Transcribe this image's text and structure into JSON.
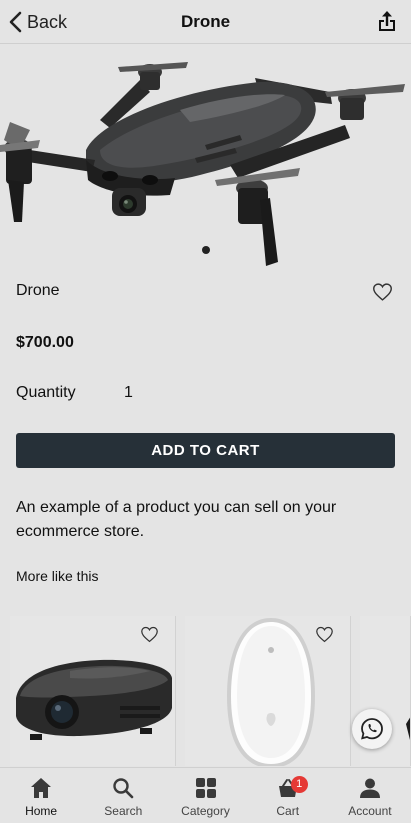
{
  "header": {
    "back_label": "Back",
    "title": "Drone"
  },
  "product": {
    "name": "Drone",
    "price": "$700.00",
    "quantity_label": "Quantity",
    "quantity_value": "1",
    "add_to_cart_label": "ADD TO CART",
    "description": "An example of a product you can sell on your ecommerce store."
  },
  "carousel": {
    "total_slides": 1,
    "active_slide": 1
  },
  "related": {
    "heading": "More like this"
  },
  "nav": {
    "items": [
      {
        "label": "Home",
        "icon": "home-icon"
      },
      {
        "label": "Search",
        "icon": "search-icon"
      },
      {
        "label": "Category",
        "icon": "category-grid-icon"
      },
      {
        "label": "Cart",
        "icon": "cart-basket-icon"
      },
      {
        "label": "Account",
        "icon": "account-icon"
      }
    ],
    "active_item": "Home",
    "cart_badge": "1"
  },
  "colors": {
    "button": "#263038",
    "badge": "#e53935",
    "background": "#e4e4e4"
  }
}
